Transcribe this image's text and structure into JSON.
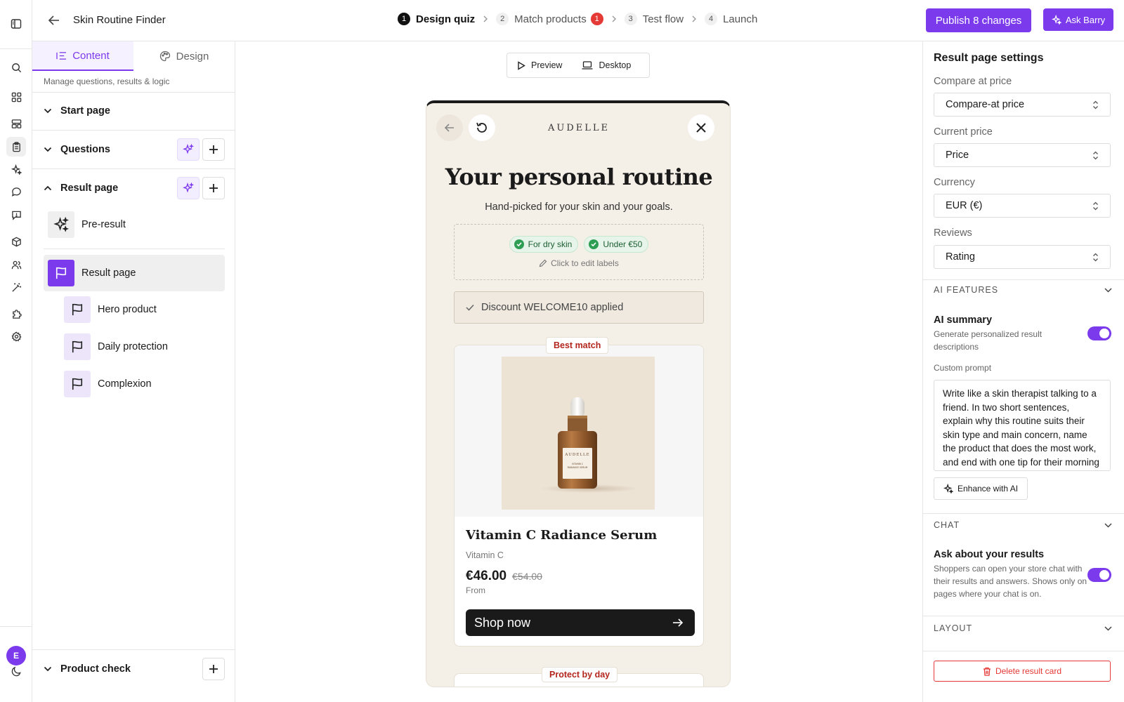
{
  "app": {
    "title": "Skin Routine Finder"
  },
  "steps": [
    {
      "num": "1",
      "label": "Design quiz",
      "active": true
    },
    {
      "num": "2",
      "label": "Match products",
      "badge": "1"
    },
    {
      "num": "3",
      "label": "Test flow"
    },
    {
      "num": "4",
      "label": "Launch"
    }
  ],
  "header": {
    "publish_label": "Publish 8 changes",
    "ask_label": "Ask Barry"
  },
  "rail": {
    "avatar": "E"
  },
  "left": {
    "tabs": [
      {
        "label": "Content"
      },
      {
        "label": "Design"
      }
    ],
    "subtitle": "Manage questions, results & logic",
    "sections": {
      "start": "Start page",
      "questions": "Questions",
      "result": "Result page",
      "product_check": "Product check"
    },
    "items": {
      "pre_result": "Pre-result",
      "result_page": "Result page",
      "hero": "Hero product",
      "daily": "Daily protection",
      "complexion": "Complexion"
    }
  },
  "canvas": {
    "preview_label": "Preview",
    "desktop_label": "Desktop",
    "brand": "AUDELLE",
    "title": "Your personal routine",
    "subtitle": "Hand-picked for your skin and your goals.",
    "labels": [
      "For dry skin",
      "Under €50"
    ],
    "edit_hint": "Click to edit labels",
    "discount": "Discount WELCOME10 applied",
    "card": {
      "badge": "Best match",
      "name": "Vitamin C Radiance Serum",
      "category": "Vitamin C",
      "price": "€46.00",
      "compare_price": "€54.00",
      "from_label": "From",
      "cta": "Shop now",
      "bottle_brand": "AUDELLE",
      "bottle_label": "VITAMIN C RADIANCE SERUM"
    },
    "card2_badge": "Protect by day"
  },
  "right": {
    "title": "Result page settings",
    "fields": [
      {
        "label": "Compare at price",
        "value": "Compare-at price"
      },
      {
        "label": "Current price",
        "value": "Price"
      },
      {
        "label": "Currency",
        "value": "EUR (€)"
      },
      {
        "label": "Reviews",
        "value": "Rating"
      }
    ],
    "ai_header": "AI FEATURES",
    "ai_summary_title": "AI summary",
    "ai_summary_desc": "Generate personalized result descriptions",
    "custom_prompt_label": "Custom prompt",
    "custom_prompt": "Write like a skin therapist talking to a friend. In two short sentences, explain why this routine suits their skin type and main concern, name the product that does the most work, and end with one tip for their morning routine.",
    "enhance_label": "Enhance with AI",
    "chat_header": "CHAT",
    "chat_title": "Ask about your results",
    "chat_desc": "Shoppers can open your store chat with their results and answers. Shows only on pages where your chat is on.",
    "layout_header": "LAYOUT",
    "delete_label": "Delete result card"
  },
  "colors": {
    "accent": "#7c3aed",
    "danger": "#e53935",
    "canvas_bg": "#f4efe7"
  }
}
